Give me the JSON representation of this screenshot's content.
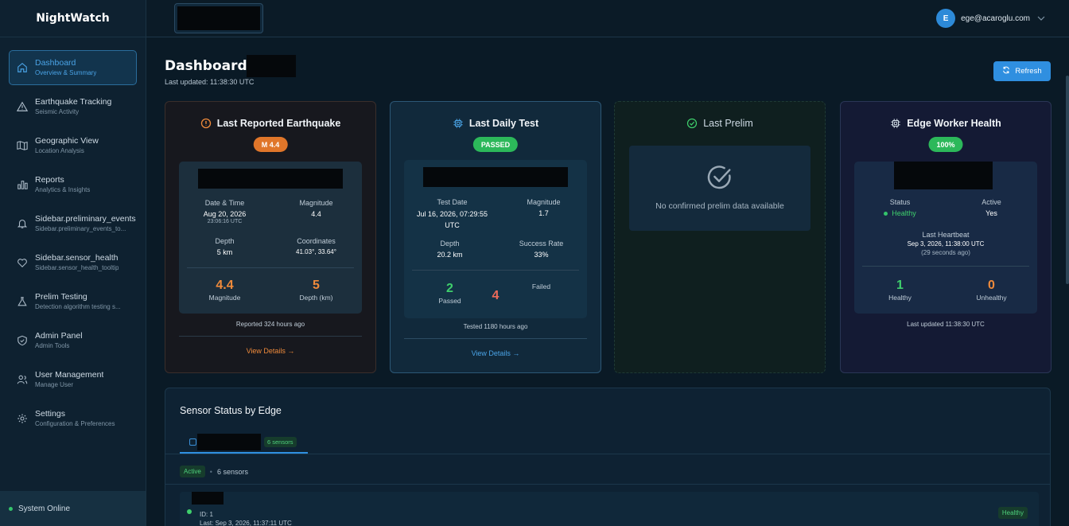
{
  "app": {
    "name": "NightWatch"
  },
  "user": {
    "initial": "E",
    "email": "ege@acaroglu.com"
  },
  "sidebar": {
    "items": [
      {
        "label": "Dashboard",
        "sub": "Overview & Summary",
        "icon": "home-icon"
      },
      {
        "label": "Earthquake Tracking",
        "sub": "Seismic Activity",
        "icon": "warning-triangle-icon"
      },
      {
        "label": "Geographic View",
        "sub": "Location Analysis",
        "icon": "map-icon"
      },
      {
        "label": "Reports",
        "sub": "Analytics & Insights",
        "icon": "bar-chart-icon"
      },
      {
        "label": "Sidebar.preliminary_events",
        "sub": "Sidebar.preliminary_events_to...",
        "icon": "bell-icon"
      },
      {
        "label": "Sidebar.sensor_health",
        "sub": "Sidebar.sensor_health_tooltip",
        "icon": "heart-icon"
      },
      {
        "label": "Prelim Testing",
        "sub": "Detection algorithm testing s...",
        "icon": "flask-icon"
      },
      {
        "label": "Admin Panel",
        "sub": "Admin Tools",
        "icon": "shield-icon"
      },
      {
        "label": "User Management",
        "sub": "Manage User",
        "icon": "users-icon"
      },
      {
        "label": "Settings",
        "sub": "Configuration & Preferences",
        "icon": "gear-icon"
      }
    ],
    "status": "System Online"
  },
  "header": {
    "title": "Dashboard -",
    "updated": "Last updated: 11:38:30 UTC",
    "refresh": "Refresh"
  },
  "earthquake": {
    "title": "Last Reported Earthquake",
    "badge": "M 4.4",
    "date_label": "Date & Time",
    "date": "Aug 20, 2026",
    "time": "23:06:16 UTC",
    "mag_label": "Magnitude",
    "mag": "4.4",
    "depth_label": "Depth",
    "depth": "5 km",
    "coord_label": "Coordinates",
    "coords": "41.03°, 33.64°",
    "big_mag": "4.4",
    "big_mag_label": "Magnitude",
    "big_depth": "5",
    "big_depth_label": "Depth (km)",
    "reported": "Reported 324 hours ago",
    "link": "View Details →"
  },
  "daily": {
    "title": "Last Daily Test",
    "badge": "PASSED",
    "date_label": "Test Date",
    "date": "Jul 16, 2026, 07:29:55 UTC",
    "mag_label": "Magnitude",
    "mag": "1.7",
    "depth_label": "Depth",
    "depth": "20.2 km",
    "rate_label": "Success Rate",
    "rate": "33%",
    "passed": "2",
    "passed_label": "Passed",
    "failed": "4",
    "failed_label": "Failed",
    "tested": "Tested 1180 hours ago",
    "link": "View Details →"
  },
  "prelim": {
    "title": "Last Prelim",
    "message": "No confirmed prelim data available"
  },
  "edge": {
    "title": "Edge Worker Health",
    "badge": "100%",
    "status_label": "Status",
    "status": "Healthy",
    "active_label": "Active",
    "active": "Yes",
    "hb_label": "Last Heartbeat",
    "hb": "Sep 3, 2026, 11:38:00 UTC",
    "hb_ago": "(29 seconds ago)",
    "healthy": "1",
    "healthy_label": "Healthy",
    "unhealthy": "0",
    "unhealthy_label": "Unhealthy",
    "updated": "Last updated 11:38:30 UTC"
  },
  "sensors": {
    "title": "Sensor Status by Edge",
    "tab_count": "6 sensors",
    "active_pill": "Active",
    "active_count": "6 sensors",
    "row": {
      "id": "ID: 1",
      "last": "Last: Sep 3, 2026, 11:37:11 UTC",
      "status": "Healthy"
    }
  },
  "colors": {
    "accent": "#2f8fe0",
    "orange": "#ef8a3b",
    "green": "#3fcf6c",
    "red": "#ee6b5a"
  }
}
